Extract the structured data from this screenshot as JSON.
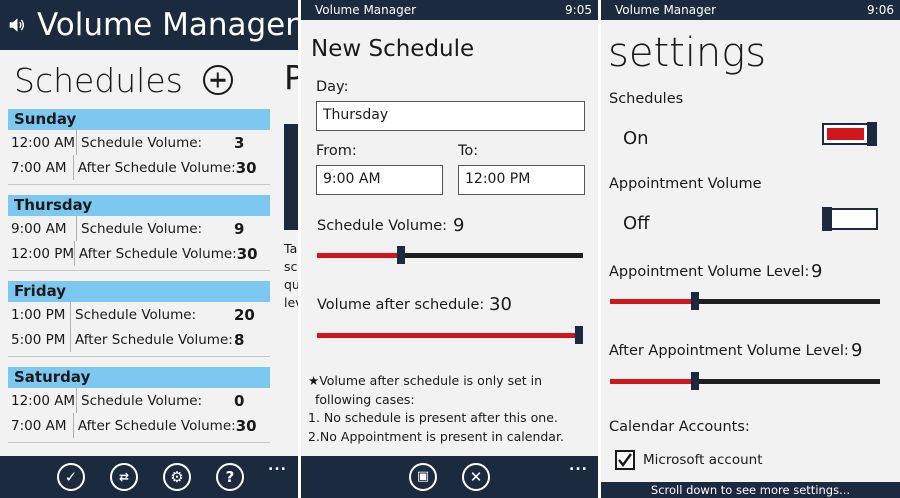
{
  "panel1": {
    "app_title": "Volume Manager",
    "page_title": "Schedules",
    "peek_letter": "P",
    "peek_text": [
      "Tap",
      "scr",
      "qu",
      "lev"
    ],
    "days": [
      {
        "name": "Sunday",
        "rows": [
          {
            "time": "12:00 AM",
            "label": "Schedule Volume:",
            "value": "3"
          },
          {
            "time": "7:00 AM",
            "label": "After Schedule Volume:",
            "value": "30"
          }
        ]
      },
      {
        "name": "Thursday",
        "rows": [
          {
            "time": "9:00 AM",
            "label": "Schedule Volume:",
            "value": "9"
          },
          {
            "time": "12:00 PM",
            "label": "After Schedule Volume:",
            "value": "30"
          }
        ]
      },
      {
        "name": "Friday",
        "rows": [
          {
            "time": "1:00 PM",
            "label": "Schedule Volume:",
            "value": "20"
          },
          {
            "time": "5:00 PM",
            "label": "After Schedule Volume:",
            "value": "8"
          }
        ]
      },
      {
        "name": "Saturday",
        "rows": [
          {
            "time": "12:00 AM",
            "label": "Schedule Volume:",
            "value": "0"
          },
          {
            "time": "7:00 AM",
            "label": "After Schedule Volume:",
            "value": "30"
          }
        ]
      }
    ],
    "appbar_icons": [
      "check-icon",
      "switch-icon",
      "settings-icon",
      "help-icon"
    ],
    "more": "..."
  },
  "panel2": {
    "status_app": "Volume Manager",
    "status_time": "9:05",
    "title": "New Schedule",
    "day_label": "Day:",
    "day_value": "Thursday",
    "from_label": "From:",
    "from_value": "9:00 AM",
    "to_label": "To:",
    "to_value": "12:00 PM",
    "schedule_volume_label": "Schedule Volume:",
    "schedule_volume_value": "9",
    "schedule_volume_level": 0.31,
    "after_volume_label": "Volume after schedule:",
    "after_volume_value": "30",
    "after_volume_level": 1.0,
    "note_lines": [
      "★Volume after schedule is only set in",
      "following cases:",
      "1. No schedule is present after this one.",
      "2.No Appointment is present in calendar."
    ],
    "appbar_icons": [
      "save-icon",
      "cancel-icon"
    ],
    "more": "..."
  },
  "panel3": {
    "status_app": "Volume Manager",
    "status_time": "9:06",
    "title": "settings",
    "schedules_label": "Schedules",
    "schedules_state": "On",
    "schedules_on": true,
    "appointment_label": "Appointment Volume",
    "appointment_state": "Off",
    "appointment_on": false,
    "appt_level_label": "Appointment Volume Level:",
    "appt_level_value": "9",
    "appt_level": 0.31,
    "after_appt_label": "After Appointment Volume Level:",
    "after_appt_value": "9",
    "after_appt_level": 0.31,
    "calendar_label": "Calendar Accounts:",
    "account_label": "Microsoft account",
    "account_checked": true,
    "scroll_hint": "Scroll down to see more settings..."
  },
  "colors": {
    "header": "#1b2a3f",
    "day_band": "#7dc8f0",
    "accent_red": "#d0151b",
    "background": "#f2f2f2"
  }
}
